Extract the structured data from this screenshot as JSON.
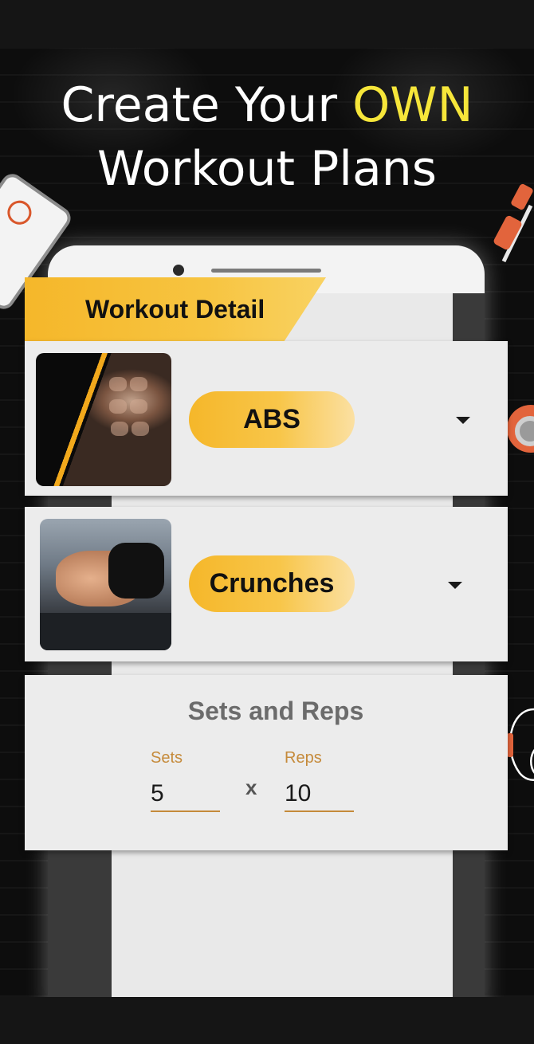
{
  "headline": {
    "line1_prefix": "Create Your",
    "line1_highlight": "OWN",
    "line2": "Workout Plans"
  },
  "colors": {
    "accent": "#f5b72a",
    "highlight": "#f6e63a",
    "field_accent": "#c58a3a",
    "background": "#0d0d0d"
  },
  "screen": {
    "title": "Workout Detail",
    "category": {
      "label": "ABS",
      "image_icon": "abs-muscle-photo",
      "dropdown_icon": "caret-down-icon"
    },
    "exercise": {
      "label": "Crunches",
      "image_icon": "crunches-photo",
      "dropdown_icon": "caret-down-icon"
    },
    "sets_reps": {
      "title": "Sets and Reps",
      "sets_label": "Sets",
      "sets_value": "5",
      "separator": "x",
      "reps_label": "Reps",
      "reps_value": "10"
    }
  }
}
